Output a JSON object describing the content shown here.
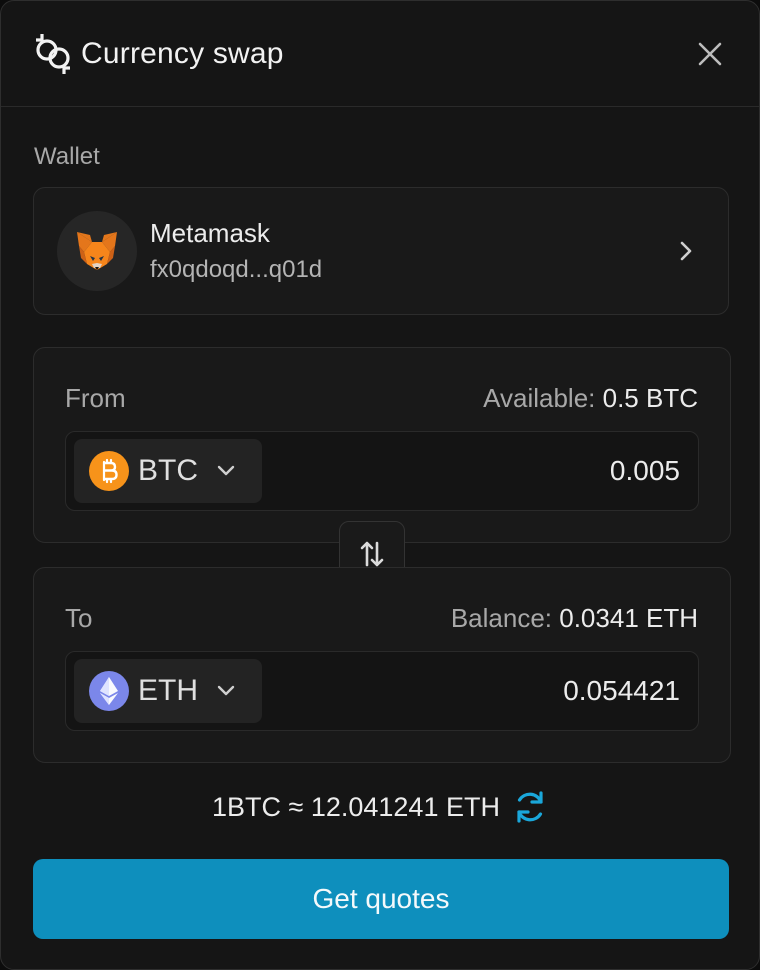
{
  "header": {
    "title": "Currency swap",
    "brand_icon": "swap-rings-icon",
    "close_icon": "close-icon"
  },
  "wallet": {
    "section_label": "Wallet",
    "name": "Metamask",
    "address": "fx0qdoqd...q01d",
    "avatar_icon": "metamask-fox-icon",
    "chevron_icon": "chevron-right-icon"
  },
  "from": {
    "label": "From",
    "info_key": "Available:",
    "info_value": "0.5 BTC",
    "token": "BTC",
    "token_icon": "bitcoin-icon",
    "token_color": "#F7931A",
    "amount": "0.005"
  },
  "to": {
    "label": "To",
    "info_key": "Balance:",
    "info_value": "0.0341 ETH",
    "token": "ETH",
    "token_icon": "ethereum-icon",
    "token_color": "#7B87EA",
    "amount": "0.054421"
  },
  "rate": {
    "text": "1BTC ≈ 12.041241 ETH",
    "refresh_icon": "refresh-icon",
    "refresh_color": "#1AA7DA"
  },
  "cta": {
    "label": "Get quotes",
    "color": "#0E8FBD"
  },
  "theme": {
    "background": "#151515",
    "card": "#191919",
    "border": "#2C2C2C",
    "muted_text": "#A8A8A8"
  }
}
